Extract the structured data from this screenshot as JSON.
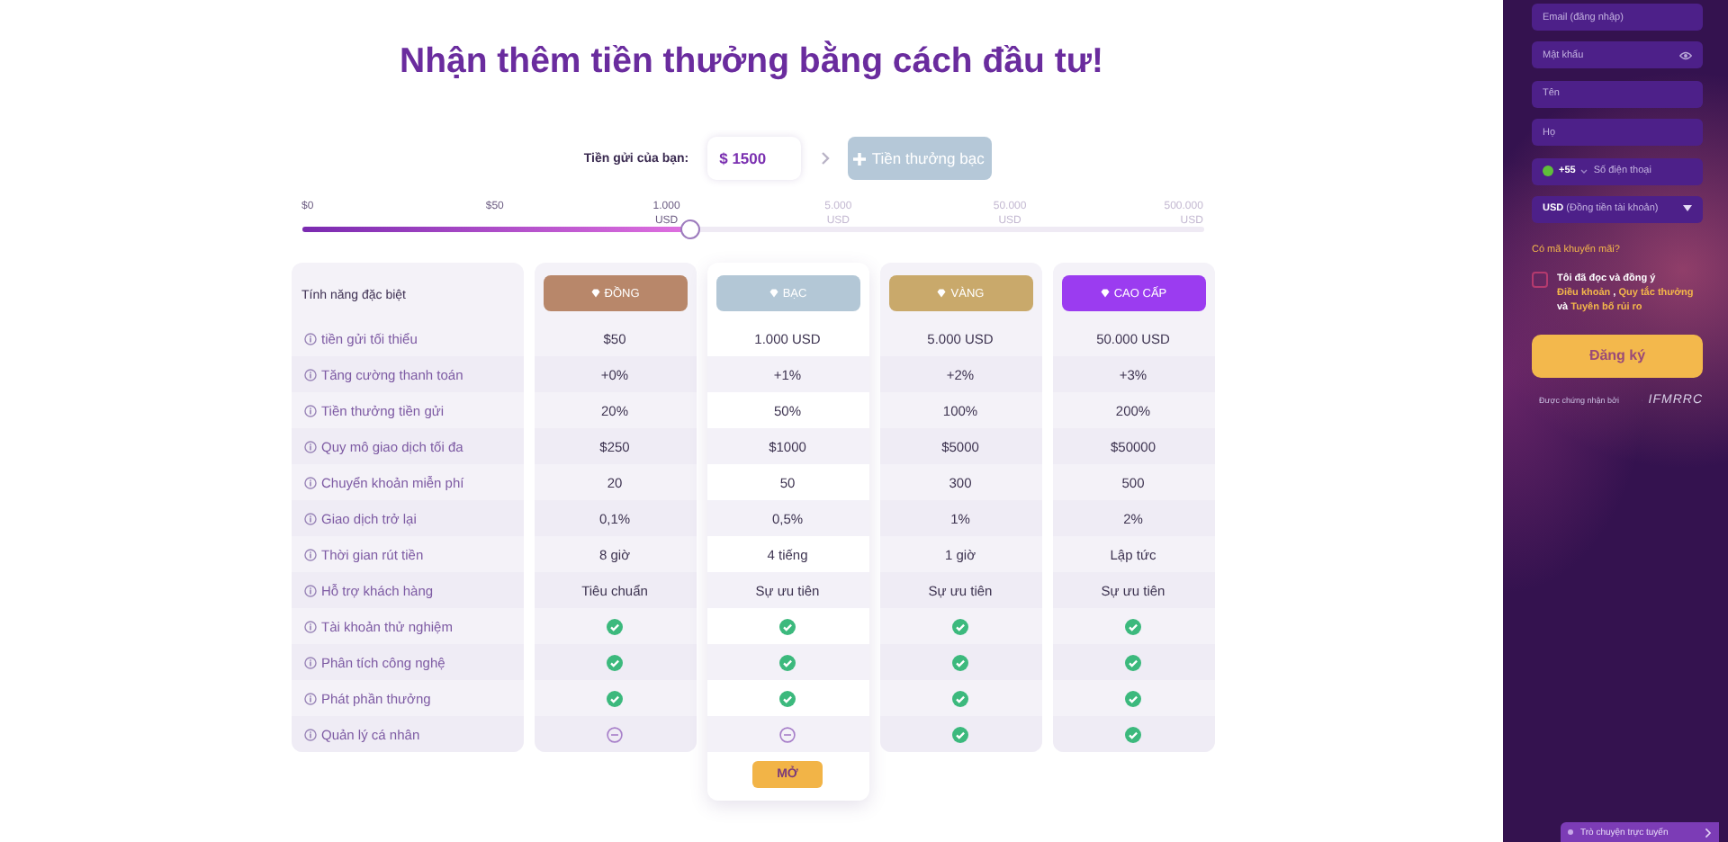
{
  "title": "Nhận thêm tiền thưởng bằng cách đầu tư!",
  "deposit": {
    "label": "Tiền gửi của bạn:",
    "value": "$ 1500",
    "bonus_button": "Tiền thưởng bạc"
  },
  "slider": {
    "level": 0.43,
    "ticks": [
      {
        "label": "$0",
        "reached": true
      },
      {
        "label": "$50",
        "reached": true
      },
      {
        "label": "1.000 USD",
        "reached": true
      },
      {
        "label": "5.000 USD",
        "reached": false
      },
      {
        "label": "50.000 USD",
        "reached": false
      },
      {
        "label": "500.000 USD",
        "reached": false
      }
    ]
  },
  "table": {
    "feature_header": "Tính năng đặc biệt",
    "plans": [
      {
        "name": "ĐỒNG",
        "color": "#b8876a",
        "selected": false
      },
      {
        "name": "BẠC",
        "color": "#b3c7d6",
        "selected": true,
        "button": "MỞ"
      },
      {
        "name": "VÀNG",
        "color": "#c9a96b",
        "selected": false
      },
      {
        "name": "CAO CẤP",
        "color": "#9b3cf0",
        "selected": false
      }
    ],
    "rows": [
      {
        "label": "tiền gửi tối thiểu",
        "values": [
          {
            "kind": "text",
            "text": "$50"
          },
          {
            "kind": "text",
            "text": "1.000 USD"
          },
          {
            "kind": "text",
            "text": "5.000 USD"
          },
          {
            "kind": "text",
            "text": "50.000 USD"
          }
        ]
      },
      {
        "label": "Tăng cường thanh toán",
        "values": [
          {
            "kind": "text",
            "text": "+0%"
          },
          {
            "kind": "text",
            "text": "+1%"
          },
          {
            "kind": "text",
            "text": "+2%"
          },
          {
            "kind": "text",
            "text": "+3%"
          }
        ]
      },
      {
        "label": "Tiền thưởng tiền gửi",
        "values": [
          {
            "kind": "text",
            "text": "20%"
          },
          {
            "kind": "text",
            "text": "50%"
          },
          {
            "kind": "text",
            "text": "100%"
          },
          {
            "kind": "text",
            "text": "200%"
          }
        ]
      },
      {
        "label": "Quy mô giao dịch tối đa",
        "values": [
          {
            "kind": "text",
            "text": "$250"
          },
          {
            "kind": "text",
            "text": "$1000"
          },
          {
            "kind": "text",
            "text": "$5000"
          },
          {
            "kind": "text",
            "text": "$50000"
          }
        ]
      },
      {
        "label": "Chuyển khoản miễn phí",
        "values": [
          {
            "kind": "text",
            "text": "20"
          },
          {
            "kind": "text",
            "text": "50"
          },
          {
            "kind": "text",
            "text": "300"
          },
          {
            "kind": "text",
            "text": "500"
          }
        ]
      },
      {
        "label": "Giao dịch trở lại",
        "values": [
          {
            "kind": "text",
            "text": "0,1%"
          },
          {
            "kind": "text",
            "text": "0,5%"
          },
          {
            "kind": "text",
            "text": "1%"
          },
          {
            "kind": "text",
            "text": "2%"
          }
        ]
      },
      {
        "label": "Thời gian rút tiền",
        "values": [
          {
            "kind": "text",
            "text": "8 giờ"
          },
          {
            "kind": "text",
            "text": "4 tiếng"
          },
          {
            "kind": "text",
            "text": "1 giờ"
          },
          {
            "kind": "text",
            "text": "Lập tức"
          }
        ]
      },
      {
        "label": "Hỗ trợ khách hàng",
        "values": [
          {
            "kind": "text",
            "text": "Tiêu chuẩn"
          },
          {
            "kind": "text",
            "text": "Sự ưu tiên"
          },
          {
            "kind": "text",
            "text": "Sự ưu tiên"
          },
          {
            "kind": "text",
            "text": "Sự ưu tiên"
          }
        ]
      },
      {
        "label": "Tài khoản thử nghiệm",
        "values": [
          {
            "kind": "check"
          },
          {
            "kind": "check"
          },
          {
            "kind": "check"
          },
          {
            "kind": "check"
          }
        ]
      },
      {
        "label": "Phân tích công nghệ",
        "values": [
          {
            "kind": "check"
          },
          {
            "kind": "check"
          },
          {
            "kind": "check"
          },
          {
            "kind": "check"
          }
        ]
      },
      {
        "label": "Phát phần thưởng",
        "values": [
          {
            "kind": "check"
          },
          {
            "kind": "check"
          },
          {
            "kind": "check"
          },
          {
            "kind": "check"
          }
        ]
      },
      {
        "label": "Quản lý cá nhân",
        "values": [
          {
            "kind": "minus"
          },
          {
            "kind": "minus"
          },
          {
            "kind": "check"
          },
          {
            "kind": "check"
          }
        ]
      }
    ]
  },
  "signup": {
    "fields": [
      {
        "kind": "text",
        "placeholder": "Email (đăng nhập)"
      },
      {
        "kind": "password",
        "placeholder": "Mật khẩu"
      },
      {
        "kind": "text",
        "placeholder": "Tên"
      },
      {
        "kind": "text",
        "placeholder": "Họ"
      },
      {
        "kind": "phone",
        "code": "+55",
        "placeholder": "Số điện thoại"
      },
      {
        "kind": "select",
        "value": "USD",
        "hint": "(Đồng tiền tài khoản)"
      }
    ],
    "promo_link": "Có mã khuyến mãi?",
    "consent": {
      "checked": false,
      "parts": [
        {
          "text": "Tôi đã đọc và đồng ý ",
          "link": false
        },
        {
          "text": "Điều khoản",
          "link": true
        },
        {
          "text": " , ",
          "link": false
        },
        {
          "text": "Quy tắc thưởng",
          "link": true
        },
        {
          "text": " và ",
          "link": false
        },
        {
          "text": "Tuyên bố rủi ro",
          "link": true
        }
      ]
    },
    "register_button": "Đăng ký",
    "certified": "Được chứng nhận bởi",
    "logo": "IFMRRC"
  },
  "chat_button": "Trò chuyện trực tuyến"
}
